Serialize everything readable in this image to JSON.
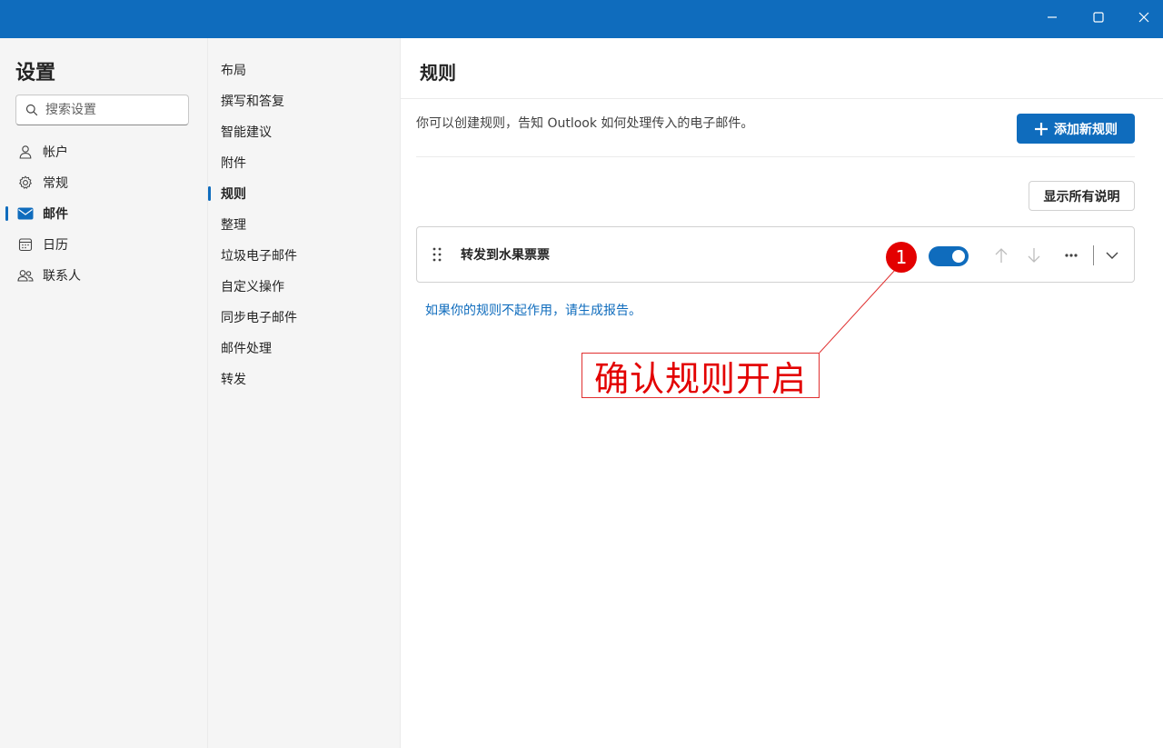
{
  "titlebar": {
    "bg_color": "#0f6cbd",
    "buttons": [
      {
        "name": "minimize-icon"
      },
      {
        "name": "maximize-icon"
      },
      {
        "name": "close-icon"
      }
    ]
  },
  "leftnav": {
    "title": "设置",
    "search_placeholder": "搜索设置",
    "items": [
      {
        "label": "帐户",
        "icon": "person-icon"
      },
      {
        "label": "常规",
        "icon": "gear-icon"
      },
      {
        "label": "邮件",
        "icon": "mail-icon",
        "active": true
      },
      {
        "label": "日历",
        "icon": "calendar-icon"
      },
      {
        "label": "联系人",
        "icon": "people-icon"
      }
    ]
  },
  "midnav": {
    "items": [
      {
        "label": "布局"
      },
      {
        "label": "撰写和答复"
      },
      {
        "label": "智能建议"
      },
      {
        "label": "附件"
      },
      {
        "label": "规则",
        "active": true
      },
      {
        "label": "整理"
      },
      {
        "label": "垃圾电子邮件"
      },
      {
        "label": "自定义操作"
      },
      {
        "label": "同步电子邮件"
      },
      {
        "label": "邮件处理"
      },
      {
        "label": "转发"
      }
    ]
  },
  "content": {
    "title": "规则",
    "description": "你可以创建规则，告知 Outlook 如何处理传入的电子邮件。",
    "add_rule_label": "添加新规则",
    "show_all_label": "显示所有说明",
    "rules": [
      {
        "name": "转发到水果票票",
        "enabled": true
      }
    ],
    "report_link": "如果你的规则不起作用，请生成报告。"
  },
  "annotation": {
    "badge": "1",
    "label": "确认规则开启",
    "color": "#e30000"
  },
  "colors": {
    "accent": "#0f6cbd",
    "nav_bg": "#f5f5f5"
  }
}
